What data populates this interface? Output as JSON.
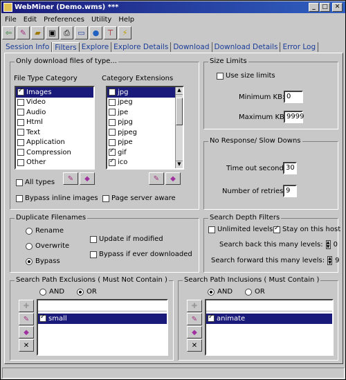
{
  "window": {
    "title": "WebMiner (Demo.wms) ***"
  },
  "menu": [
    "File",
    "Edit",
    "Preferences",
    "Utility",
    "Help"
  ],
  "toolbar": [
    "exit-icon",
    "wand-icon",
    "open-icon",
    "save-icon",
    "print-icon",
    "monitor-icon",
    "globe-icon",
    "antenna-icon",
    "bolt-icon"
  ],
  "tabs": [
    "Session Info",
    "Filters",
    "Explore",
    "Explore Details",
    "Download",
    "Download Details",
    "Error Log"
  ],
  "active_tab": "Filters",
  "filetypes": {
    "group_title": "Only download files of type...",
    "category_label": "File Type Category",
    "extensions_label": "Category Extensions",
    "categories": [
      {
        "label": "Images",
        "checked": true,
        "selected": true
      },
      {
        "label": "Video",
        "checked": false
      },
      {
        "label": "Audio",
        "checked": false
      },
      {
        "label": "Html",
        "checked": false
      },
      {
        "label": "Text",
        "checked": false
      },
      {
        "label": "Application",
        "checked": false
      },
      {
        "label": "Compression",
        "checked": false
      },
      {
        "label": "Other",
        "checked": false
      }
    ],
    "extensions": [
      {
        "label": "jpg",
        "checked": false,
        "selected": true
      },
      {
        "label": "jpeg",
        "checked": false
      },
      {
        "label": "jpe",
        "checked": false
      },
      {
        "label": "pjpg",
        "checked": false
      },
      {
        "label": "pjpeg",
        "checked": false
      },
      {
        "label": "pjpe",
        "checked": false
      },
      {
        "label": "gif",
        "checked": true
      },
      {
        "label": "ico",
        "checked": true
      }
    ],
    "all_types": "All types",
    "bypass_inline": "Bypass inline images",
    "page_server_aware": "Page server aware"
  },
  "size_limits": {
    "group_title": "Size Limits",
    "use_size_limits": "Use size limits",
    "min_label": "Minimum KB:",
    "min_value": "0",
    "max_label": "Maximum KB:",
    "max_value": "9999"
  },
  "no_response": {
    "group_title": "No Response/ Slow Downs",
    "timeout_label": "Time out seconds:",
    "timeout_value": "30",
    "retries_label": "Number of retries:",
    "retries_value": "9"
  },
  "duplicates": {
    "group_title": "Duplicate Filenames",
    "rename": "Rename",
    "overwrite": "Overwrite",
    "bypass": "Bypass",
    "update_if_modified": "Update if modified",
    "bypass_if_downloaded": "Bypass if ever downloaded"
  },
  "depth": {
    "group_title": "Search Depth Filters",
    "unlimited": "Unlimited levels",
    "stay_on_host": "Stay on this host",
    "back_label": "Search back this many levels:",
    "back_value": "0",
    "forward_label": "Search forward this many levels:",
    "forward_value": "9"
  },
  "exclusions": {
    "group_title": "Search Path Exclusions ( Must Not Contain )",
    "and": "AND",
    "or": "OR",
    "items": [
      "small"
    ]
  },
  "inclusions": {
    "group_title": "Search Path Inclusions ( Must Contain )",
    "and": "AND",
    "or": "OR",
    "items": [
      "animate"
    ]
  }
}
